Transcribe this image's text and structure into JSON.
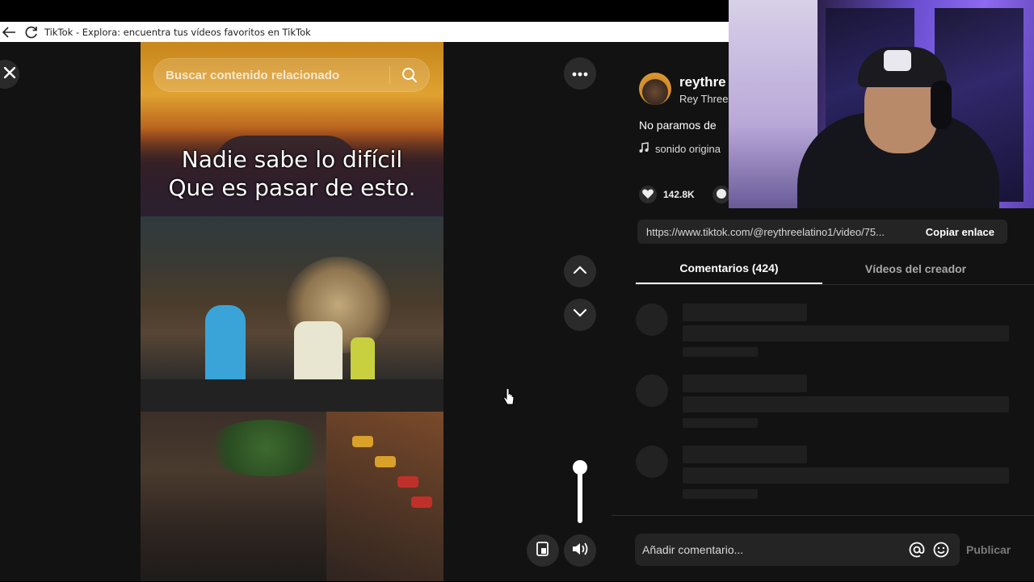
{
  "browser": {
    "title": "TikTok - Explora: encuentra tus vídeos favoritos en TikTok"
  },
  "video": {
    "search_placeholder": "Buscar contenido relacionado",
    "caption_line1": "Nadie sabe lo difícil",
    "caption_line2": "Que es pasar de esto.",
    "volume_level": 1.0
  },
  "post": {
    "username": "reythre",
    "nickname": "Rey Three",
    "description": "No paramos de",
    "sound": "sonido origina",
    "likes": "142.8K"
  },
  "share": {
    "url": "https://www.tiktok.com/@reythreelatino1/video/75...",
    "copy_label": "Copiar enlace"
  },
  "tabs": [
    {
      "label": "Comentarios (424)",
      "active": true
    },
    {
      "label": "Vídeos del creador",
      "active": false
    }
  ],
  "comment_box": {
    "placeholder": "Añadir comentario...",
    "publish_label": "Publicar"
  },
  "icons": {
    "close": "close-icon",
    "more": "more-icon",
    "up": "chevron-up-icon",
    "down": "chevron-down-icon",
    "volume": "volume-icon",
    "mini_player": "mini-player-icon",
    "search": "search-icon",
    "music": "music-note-icon",
    "heart": "heart-icon",
    "at": "at-icon",
    "emoji": "emoji-icon"
  }
}
